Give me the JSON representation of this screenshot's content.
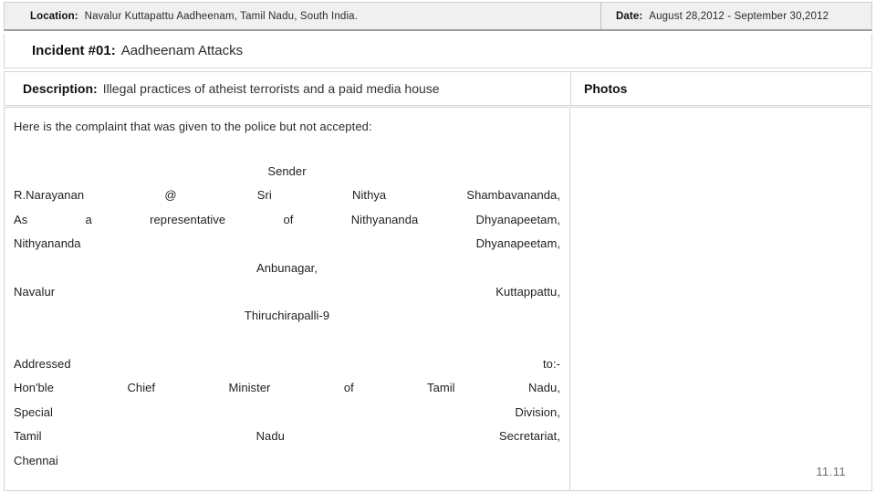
{
  "meta": {
    "location_label": "Location:",
    "location_value": "Navalur Kuttapattu  Aadheenam, Tamil Nadu, South India.",
    "date_label": "Date:",
    "date_value": "August 28,2012 - September 30,2012"
  },
  "incident": {
    "label": "Incident #01:",
    "title": "Aadheenam Attacks"
  },
  "sections": {
    "description_label": "Description:",
    "description_value": "Illegal practices of atheist terrorists and a paid media house",
    "photos_label": "Photos"
  },
  "complaint": {
    "intro": "Here is the complaint that was given to the police but not accepted:",
    "sender_heading": "Sender",
    "lines": [
      {
        "text": "R.Narayanan @ Sri Nithya Shambavananda,",
        "align": "justify"
      },
      {
        "text": "As a representative of Nithyananda Dhyanapeetam,",
        "align": "justify"
      },
      {
        "text": "Nithyananda Dhyanapeetam,",
        "align": "justify"
      },
      {
        "text": "Anbunagar,",
        "align": "center"
      },
      {
        "text": "Navalur Kuttappattu,",
        "align": "justify"
      },
      {
        "text": "Thiruchirapalli-9",
        "align": "center"
      },
      {
        "text": "",
        "align": "left"
      },
      {
        "text": "Addressed to:-",
        "align": "justify"
      },
      {
        "text": "Hon'ble Chief Minister of Tamil Nadu,",
        "align": "justify"
      },
      {
        "text": "Special Division,",
        "align": "justify"
      },
      {
        "text": "Tamil Nadu Secretariat,",
        "align": "justify"
      },
      {
        "text": "Chennai",
        "align": "left"
      }
    ]
  },
  "footer": {
    "page_number": "11.11"
  },
  "colors": {
    "header_background": "#f0f0f0",
    "border": "#d4d4d4",
    "header_rule": "#9e9e9e",
    "text": "#1f1f1f",
    "page_number": "#6b6b6b"
  }
}
